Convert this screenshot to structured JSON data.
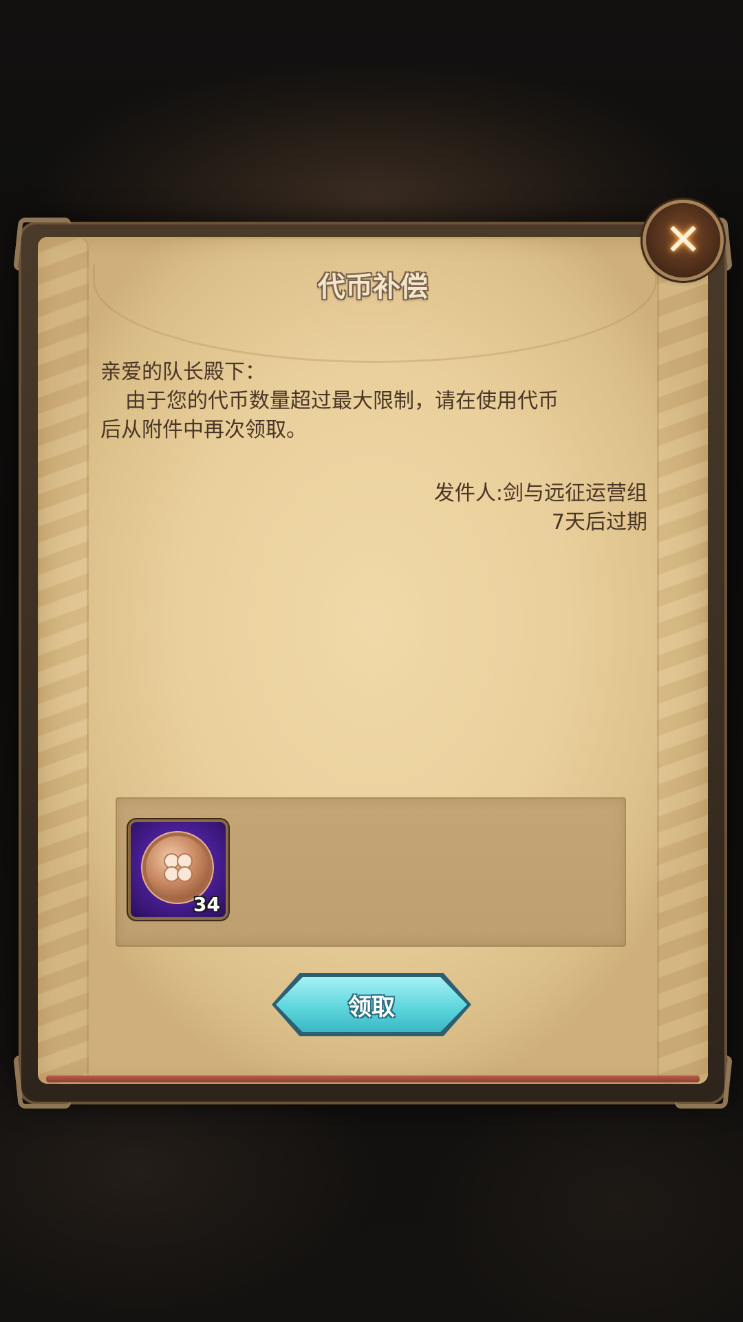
{
  "dialog": {
    "title": "代币补偿",
    "greeting": "亲爱的队长殿下：",
    "message_line1": "由于您的代币数量超过最大限制，请在使用代币",
    "message_line2": "后从附件中再次领取。",
    "sender": "发件人:剑与远征运营组",
    "expiry": "7天后过期",
    "close_icon": "close-x-icon"
  },
  "attachment": {
    "items": [
      {
        "icon": "clover-coin-icon",
        "count": "34"
      }
    ]
  },
  "actions": {
    "claim_label": "领取"
  },
  "colors": {
    "parchment": "#e9cf9b",
    "text": "#4a3526",
    "claim_button": "#5fd6dd",
    "item_slot": "#4a1f96"
  }
}
